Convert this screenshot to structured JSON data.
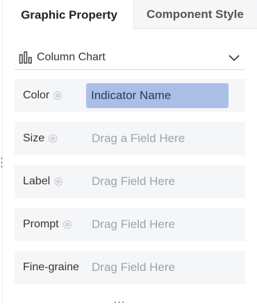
{
  "tabs": {
    "active": "Graphic Property",
    "inactive": "Component Style"
  },
  "chart_type": {
    "label": "Column Chart",
    "icon": "column-chart-icon"
  },
  "fields": [
    {
      "label": "Color",
      "value": "Indicator Name",
      "placeholder": ""
    },
    {
      "label": "Size",
      "value": "",
      "placeholder": "Drag a Field Here"
    },
    {
      "label": "Label",
      "value": "",
      "placeholder": "Drag Field Here"
    },
    {
      "label": "Prompt",
      "value": "",
      "placeholder": "Drag Field Here"
    },
    {
      "label": "Fine-graine",
      "value": "",
      "placeholder": "Drag Field Here"
    }
  ],
  "colors": {
    "chip": "#aabfe8",
    "row_bg": "#f5f6f8",
    "placeholder": "#9ea3ab"
  }
}
